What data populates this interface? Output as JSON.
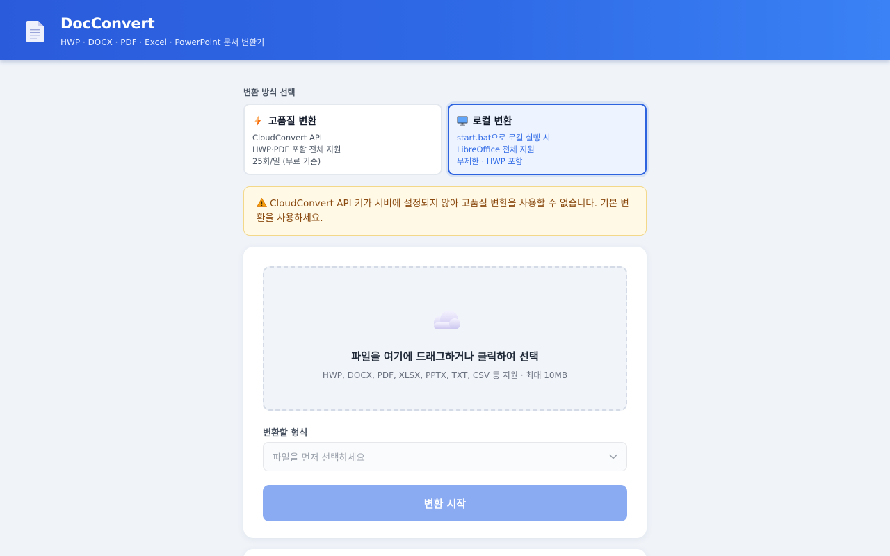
{
  "header": {
    "title": "DocConvert",
    "subtitle": "HWP · DOCX · PDF · Excel · PowerPoint 문서 변환기",
    "logo_icon": "document-icon"
  },
  "mode_section": {
    "label": "변환 방식 선택",
    "options": [
      {
        "title": "고품질 변환",
        "icon": "lightning-icon",
        "lines": [
          "CloudConvert API",
          "HWP·PDF 포함 전체 지원",
          "25회/일 (무료 기준)"
        ],
        "selected": false
      },
      {
        "title": "로컬 변환",
        "icon": "computer-icon",
        "lines": [
          "start.bat으로 로컬 실행 시",
          "LibreOffice 전체 지원",
          "무제한 · HWP 포함"
        ],
        "selected": true
      }
    ]
  },
  "alert": {
    "icon": "warning-icon",
    "text": "CloudConvert API 키가 서버에 설정되지 않아 고품질 변환을 사용할 수 없습니다. 기본 변환을 사용하세요."
  },
  "upload": {
    "icon": "cloud-icon",
    "title": "파일을 여기에 드래그하거나 클릭하여 선택",
    "hint": "HWP, DOCX, PDF, XLSX, PPTX, TXT, CSV 등 지원 · 최대 10MB"
  },
  "format": {
    "label": "변환할 형식",
    "placeholder": "파일을 먼저 선택하세요"
  },
  "start_button": {
    "label": "변환 시작"
  },
  "colors": {
    "header_start": "#2a5bdb",
    "header_end": "#3a82f5",
    "accent": "#2e63e0",
    "button_disabled": "#8aabf2",
    "alert_bg": "#fff9e6",
    "alert_text": "#8a4a10"
  }
}
